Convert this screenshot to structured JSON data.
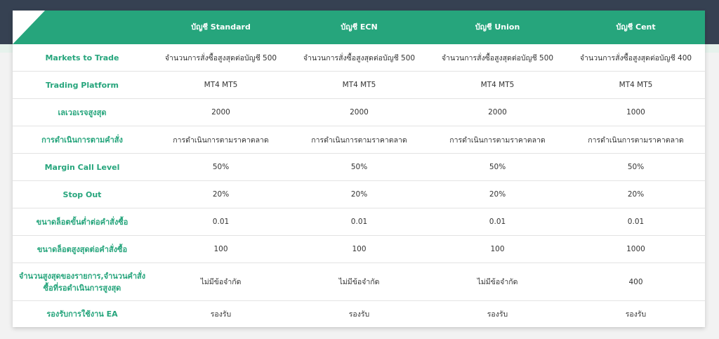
{
  "columns": [
    "บัญชี Standard",
    "บัญชี ECN",
    "บัญชี Union",
    "บัญชี Cent"
  ],
  "rows": [
    {
      "label": "Markets to Trade",
      "values": [
        "จำนวนการสั่งซื้อสูงสุดต่อบัญชี 500",
        "จำนวนการสั่งซื้อสูงสุดต่อบัญชี 500",
        "จำนวนการสั่งซื้อสูงสุดต่อบัญชี 500",
        "จำนวนการสั่งซื้อสูงสุดต่อบัญชี 400"
      ]
    },
    {
      "label": "Trading Platform",
      "values": [
        "MT4 MT5",
        "MT4 MT5",
        "MT4 MT5",
        "MT4 MT5"
      ]
    },
    {
      "label": "เลเวอเรจสูงสุด",
      "values": [
        "2000",
        "2000",
        "2000",
        "1000"
      ]
    },
    {
      "label": "การดำเนินการตามคำสั่ง",
      "values": [
        "การดำเนินการตามราคาตลาด",
        "การดำเนินการตามราคาตลาด",
        "การดำเนินการตามราคาตลาด",
        "การดำเนินการตามราคาตลาด"
      ]
    },
    {
      "label": "Margin Call Level",
      "values": [
        "50%",
        "50%",
        "50%",
        "50%"
      ]
    },
    {
      "label": "Stop Out",
      "values": [
        "20%",
        "20%",
        "20%",
        "20%"
      ]
    },
    {
      "label": "ขนาดล็อตขั้นต่ำต่อคำสั่งซื้อ",
      "values": [
        "0.01",
        "0.01",
        "0.01",
        "0.01"
      ]
    },
    {
      "label": "ขนาดล็อตสูงสุดต่อคำสั่งซื้อ",
      "values": [
        "100",
        "100",
        "100",
        "1000"
      ]
    },
    {
      "label": "จำนวนสูงสุดของรายการ,จำนวนคำสั่งซื้อที่รอดำเนินการสูงสุด",
      "values": [
        "ไม่มีข้อจำกัด",
        "ไม่มีข้อจำกัด",
        "ไม่มีข้อจำกัด",
        "400"
      ]
    },
    {
      "label": "รองรับการใช้งาน EA",
      "values": [
        "รองรับ",
        "รองรับ",
        "รองรับ",
        "รองรับ"
      ]
    }
  ],
  "colors": {
    "accent": "#26a57c",
    "header_bg": "#364152",
    "text": "#333333"
  }
}
